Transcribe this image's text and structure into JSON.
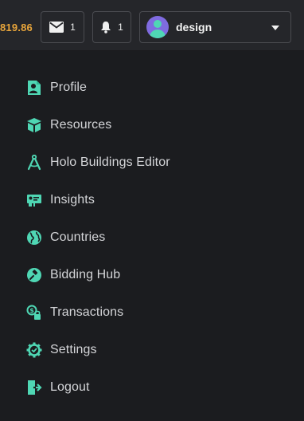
{
  "header": {
    "balance": "819.86",
    "mail": {
      "icon": "mail-icon",
      "count": "1"
    },
    "notifications": {
      "icon": "bell-icon",
      "count": "1"
    },
    "user": {
      "name": "design",
      "avatar": "avatar",
      "dropdown_icon": "caret-down-icon"
    }
  },
  "colors": {
    "accent": "#4fd7b4",
    "balance": "#e8a53b",
    "background": "#1b1c1f",
    "topbar": "#25262a",
    "avatar_bg": "#7f6be0"
  },
  "menu": {
    "items": [
      {
        "label": "Profile",
        "icon": "profile-icon"
      },
      {
        "label": "Resources",
        "icon": "resources-box-icon"
      },
      {
        "label": "Holo Buildings Editor",
        "icon": "compass-drafting-icon"
      },
      {
        "label": "Insights",
        "icon": "insights-presentation-icon"
      },
      {
        "label": "Countries",
        "icon": "globe-icon"
      },
      {
        "label": "Bidding Hub",
        "icon": "gavel-icon"
      },
      {
        "label": "Transactions",
        "icon": "transactions-lock-icon"
      },
      {
        "label": "Settings",
        "icon": "gear-icon"
      },
      {
        "label": "Logout",
        "icon": "logout-icon"
      }
    ]
  }
}
